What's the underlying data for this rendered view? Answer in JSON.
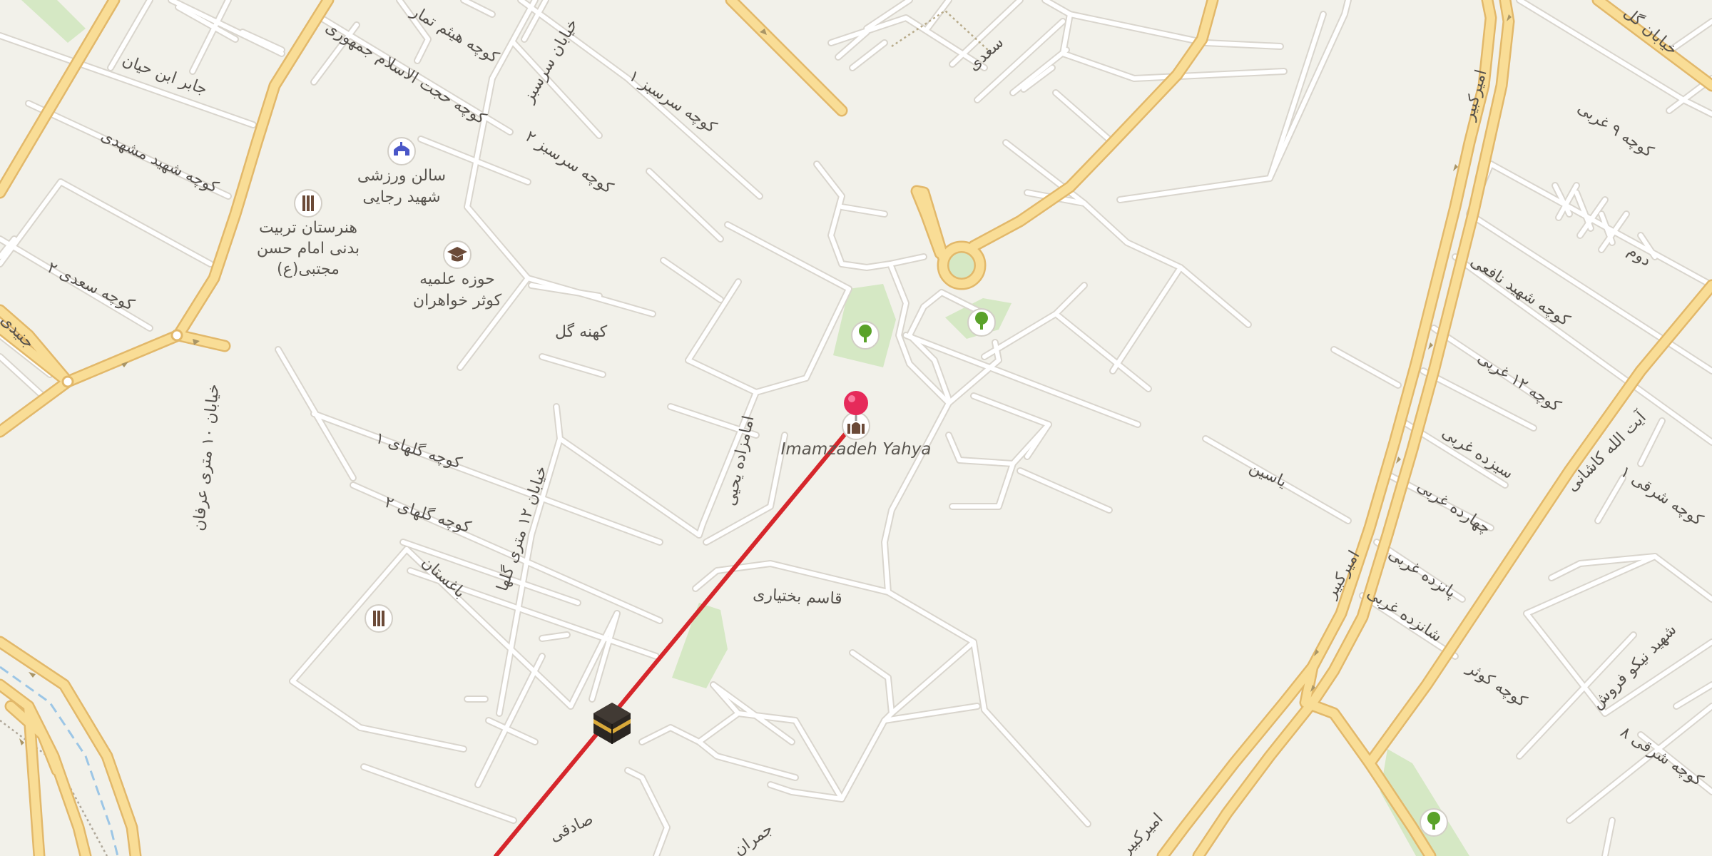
{
  "map": {
    "colors": {
      "background": "#f2f1ea",
      "minor_road": "#ffffff",
      "minor_road_casing": "#d9d5cd",
      "major_road": "#f9dd96",
      "major_road_casing": "#e2b86a",
      "park": "#d5e8c4",
      "water_dash": "#9cc6e6",
      "route_line": "#d6262b",
      "pin": "#e62a5a"
    },
    "street_labels": [
      "کوچه هیثم تمار",
      "کوچه حجت الاسلام جمهوری",
      "خیابان سرسبز",
      "کوچه سرسبز ۱",
      "کوچه سرسبز ۲",
      "جابر ابن حیان",
      "کوچه شهید مشهدی",
      "کوچه سعدی ۲",
      "خیابان ۱۰ متری عرفان",
      "کوچه گلهای ۱",
      "کوچه گلهای ۲",
      "خیابان ۱۲ متری گلها",
      "باغستان",
      "امامزاده یحیی",
      "قاسم بختیاری",
      "صادقی",
      "جمران",
      "سعدی",
      "یاسین",
      "امیرکبیر",
      "کوچه ۹ غربی",
      "کوچه شهید نافعی",
      "کوچه ۱۲ غربی",
      "سیزده غربی",
      "چهارده غربی",
      "پانزده غربی",
      "شانزده غربی",
      "کوچه کوثر",
      "کوچه شرقی ۱",
      "آیت الله کاشانی",
      "شهید نیکو فروش",
      "کوچه شرقی ۸",
      "دوم",
      "خیابان گل",
      "کهنه گل",
      "جنیدی"
    ],
    "pois": [
      {
        "icon": "mosque-icon",
        "label_line1": "سالن ورزشی",
        "label_line2": "شهید رجایی"
      },
      {
        "icon": "school-icon",
        "label_line1": "هنرستان تربیت",
        "label_line2": "بدنی امام حسن",
        "label_line3": "مجتبی(ع)"
      },
      {
        "icon": "graduation-cap-icon",
        "label_line1": "حوزه علمیه",
        "label_line2": "کوثر خواهران"
      },
      {
        "icon": "school-icon"
      },
      {
        "icon": "tree-icon"
      },
      {
        "icon": "tree-icon"
      },
      {
        "icon": "tree-icon"
      }
    ],
    "selected_place": {
      "name": "Imamzadeh Yahya",
      "icon": "shrine-icon",
      "marker": "location-pin-icon"
    },
    "qibla_marker": {
      "icon": "kaaba-icon"
    }
  }
}
